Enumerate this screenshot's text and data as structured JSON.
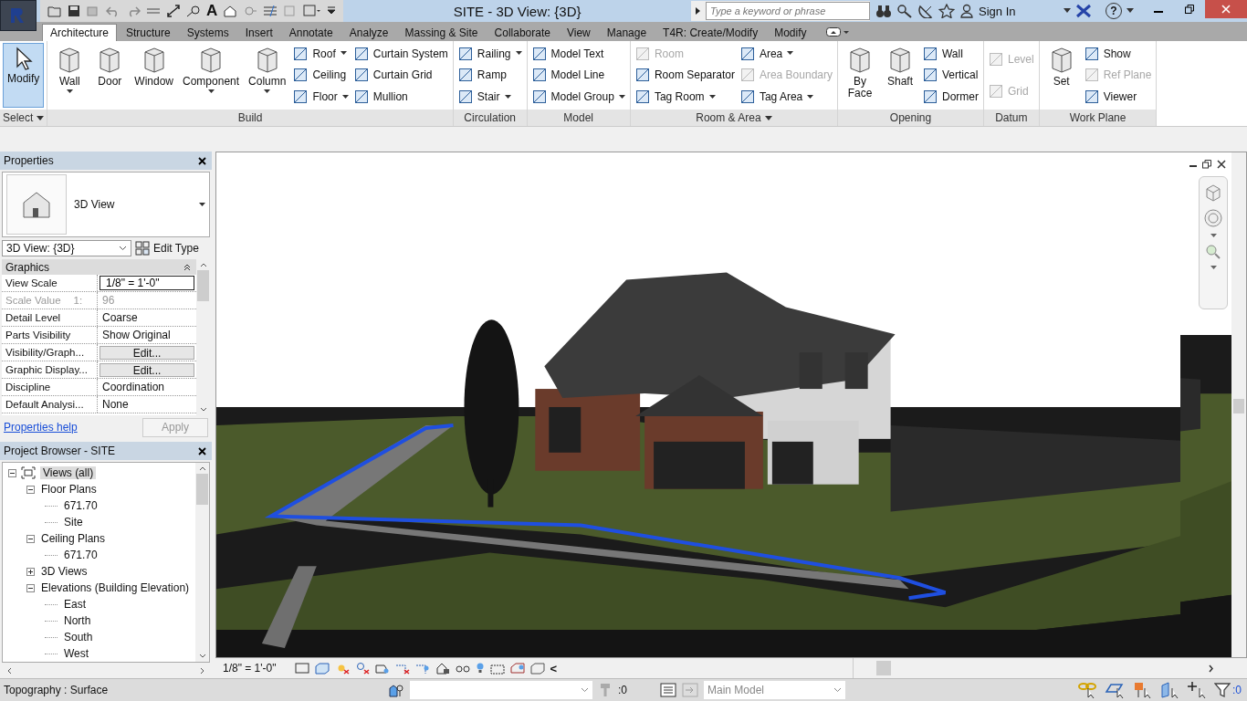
{
  "window": {
    "title": "SITE - 3D View: {3D}"
  },
  "quick_access": {
    "text_tool": "A"
  },
  "search": {
    "placeholder": "Type a keyword or phrase"
  },
  "account": {
    "label": "Sign In"
  },
  "help": {
    "label": "?"
  },
  "tabs": [
    {
      "label": "Architecture",
      "selected": true
    },
    {
      "label": "Structure",
      "selected": false
    },
    {
      "label": "Systems",
      "selected": false
    },
    {
      "label": "Insert",
      "selected": false
    },
    {
      "label": "Annotate",
      "selected": false
    },
    {
      "label": "Analyze",
      "selected": false
    },
    {
      "label": "Massing & Site",
      "selected": false
    },
    {
      "label": "Collaborate",
      "selected": false
    },
    {
      "label": "View",
      "selected": false
    },
    {
      "label": "Manage",
      "selected": false
    },
    {
      "label": "T4R: Create/Modify",
      "selected": false
    },
    {
      "label": "Modify",
      "selected": false
    }
  ],
  "ribbon": [
    {
      "title": "Select",
      "menu": true,
      "items": [
        {
          "kind": "large",
          "label": "Modify",
          "selected": true,
          "dropdown": false
        }
      ]
    },
    {
      "title": "Build",
      "menu": false,
      "items": [
        {
          "kind": "large",
          "label": "Wall",
          "selected": false,
          "dropdown": true
        },
        {
          "kind": "large",
          "label": "Door",
          "selected": false,
          "dropdown": false
        },
        {
          "kind": "large",
          "label": "Window",
          "selected": false,
          "dropdown": false
        },
        {
          "kind": "large",
          "label": "Component",
          "selected": false,
          "dropdown": true
        },
        {
          "kind": "large",
          "label": "Column",
          "selected": false,
          "dropdown": true
        },
        {
          "kind": "stack",
          "tools": [
            {
              "label": "Roof",
              "dropdown": true,
              "disabled": false
            },
            {
              "label": "Ceiling",
              "dropdown": false,
              "disabled": false
            },
            {
              "label": "Floor",
              "dropdown": true,
              "disabled": false
            }
          ]
        },
        {
          "kind": "stack",
          "tools": [
            {
              "label": "Curtain System",
              "dropdown": false,
              "disabled": false
            },
            {
              "label": "Curtain Grid",
              "dropdown": false,
              "disabled": false
            },
            {
              "label": "Mullion",
              "dropdown": false,
              "disabled": false
            }
          ]
        }
      ]
    },
    {
      "title": "Circulation",
      "menu": false,
      "items": [
        {
          "kind": "stack",
          "tools": [
            {
              "label": "Railing",
              "dropdown": true,
              "disabled": false
            },
            {
              "label": "Ramp",
              "dropdown": false,
              "disabled": false
            },
            {
              "label": "Stair",
              "dropdown": true,
              "disabled": false
            }
          ]
        }
      ]
    },
    {
      "title": "Model",
      "menu": false,
      "items": [
        {
          "kind": "stack",
          "tools": [
            {
              "label": "Model Text",
              "dropdown": false,
              "disabled": false
            },
            {
              "label": "Model Line",
              "dropdown": false,
              "disabled": false
            },
            {
              "label": "Model Group",
              "dropdown": true,
              "disabled": false
            }
          ]
        }
      ]
    },
    {
      "title": "Room & Area",
      "menu": true,
      "items": [
        {
          "kind": "stack",
          "tools": [
            {
              "label": "Room",
              "dropdown": false,
              "disabled": true
            },
            {
              "label": "Room Separator",
              "dropdown": false,
              "disabled": false
            },
            {
              "label": "Tag Room",
              "dropdown": true,
              "disabled": false
            }
          ]
        },
        {
          "kind": "stack",
          "tools": [
            {
              "label": "Area",
              "dropdown": true,
              "disabled": false
            },
            {
              "label": "Area Boundary",
              "dropdown": false,
              "disabled": true
            },
            {
              "label": "Tag Area",
              "dropdown": true,
              "disabled": false
            }
          ]
        }
      ]
    },
    {
      "title": "Opening",
      "menu": false,
      "items": [
        {
          "kind": "large",
          "label": "By Face",
          "selected": false,
          "dropdown": false
        },
        {
          "kind": "large",
          "label": "Shaft",
          "selected": false,
          "dropdown": false
        },
        {
          "kind": "stack",
          "tools": [
            {
              "label": "Wall",
              "dropdown": false,
              "disabled": false
            },
            {
              "label": "Vertical",
              "dropdown": false,
              "disabled": false
            },
            {
              "label": "Dormer",
              "dropdown": false,
              "disabled": false
            }
          ]
        }
      ]
    },
    {
      "title": "Datum",
      "menu": false,
      "items": [
        {
          "kind": "stack",
          "tools": [
            {
              "label": "Level",
              "dropdown": false,
              "disabled": true
            },
            {
              "label": "Grid",
              "dropdown": false,
              "disabled": true
            }
          ]
        }
      ]
    },
    {
      "title": "Work Plane",
      "menu": false,
      "items": [
        {
          "kind": "large",
          "label": "Set",
          "selected": false,
          "dropdown": false
        },
        {
          "kind": "stack",
          "tools": [
            {
              "label": "Show",
              "dropdown": false,
              "disabled": false
            },
            {
              "label": "Ref Plane",
              "dropdown": false,
              "disabled": true
            },
            {
              "label": "Viewer",
              "dropdown": false,
              "disabled": false
            }
          ]
        }
      ]
    }
  ],
  "properties": {
    "title": "Properties",
    "type_name": "3D View",
    "type_selector": "3D View: {3D}",
    "edit_type": "Edit Type",
    "group": "Graphics",
    "rows": [
      {
        "name": "View Scale",
        "suffix": "",
        "value": "1/8\" = 1'-0\"",
        "kind": "field",
        "disabled": false
      },
      {
        "name": "Scale Value",
        "suffix": "1:",
        "value": "96",
        "kind": "text",
        "disabled": true
      },
      {
        "name": "Detail Level",
        "suffix": "",
        "value": "Coarse",
        "kind": "text",
        "disabled": false
      },
      {
        "name": "Parts Visibility",
        "suffix": "",
        "value": "Show Original",
        "kind": "text",
        "disabled": false
      },
      {
        "name": "Visibility/Graph...",
        "suffix": "",
        "value": "Edit...",
        "kind": "button",
        "disabled": false
      },
      {
        "name": "Graphic Display...",
        "suffix": "",
        "value": "Edit...",
        "kind": "button",
        "disabled": false
      },
      {
        "name": "Discipline",
        "suffix": "",
        "value": "Coordination",
        "kind": "text",
        "disabled": false
      },
      {
        "name": "Default Analysi...",
        "suffix": "",
        "value": "None",
        "kind": "text",
        "disabled": false
      }
    ],
    "help_link": "Properties help",
    "apply": {
      "label": "Apply",
      "disabled": true
    }
  },
  "browser": {
    "title": "Project Browser - SITE",
    "tree": [
      {
        "label": "Views (all)",
        "selected": true,
        "expanded": true,
        "children": [
          {
            "label": "Floor Plans",
            "selected": false,
            "expanded": true,
            "children": [
              {
                "label": "671.70",
                "selected": false
              },
              {
                "label": "Site",
                "selected": false
              }
            ]
          },
          {
            "label": "Ceiling Plans",
            "selected": false,
            "expanded": true,
            "children": [
              {
                "label": "671.70",
                "selected": false
              }
            ]
          },
          {
            "label": "3D Views",
            "selected": false,
            "expanded": false
          },
          {
            "label": "Elevations (Building Elevation)",
            "selected": false,
            "expanded": true,
            "children": [
              {
                "label": "East",
                "selected": false
              },
              {
                "label": "North",
                "selected": false
              },
              {
                "label": "South",
                "selected": false
              },
              {
                "label": "West",
                "selected": false
              }
            ]
          }
        ]
      }
    ]
  },
  "view_bar": {
    "scale": "1/8\" = 1'-0\"",
    "collapse": "<"
  },
  "status_bar": {
    "message": "Topography : Surface",
    "workset_count": ":0",
    "design_option": {
      "value": "Main Model",
      "disabled": true
    },
    "filter_count": ":0"
  }
}
